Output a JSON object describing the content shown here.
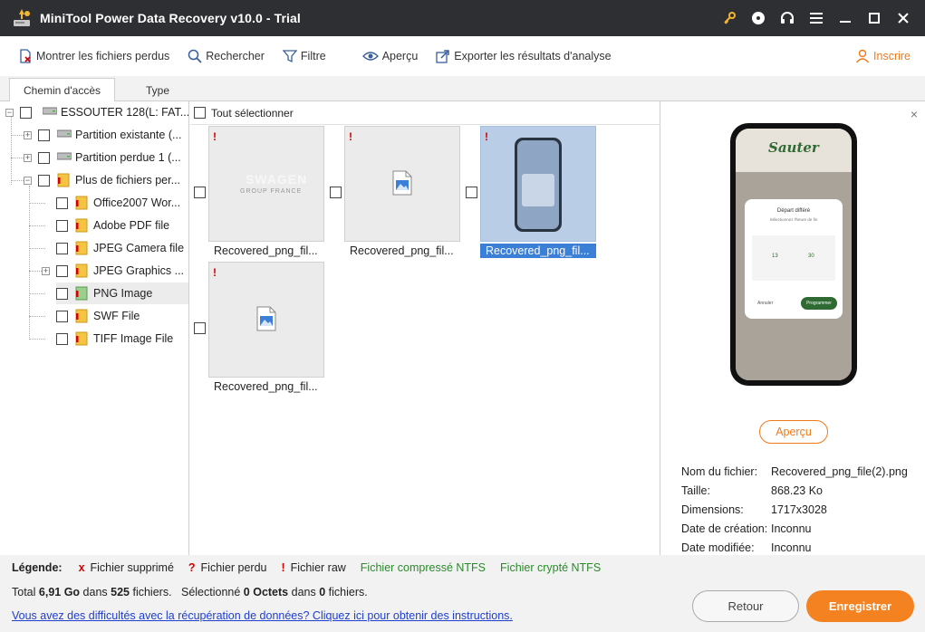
{
  "window": {
    "title": "MiniTool Power Data Recovery v10.0 - Trial"
  },
  "toolbar": {
    "show_lost": "Montrer les fichiers perdus",
    "search": "Rechercher",
    "filter": "Filtre",
    "preview": "Aperçu",
    "export": "Exporter les résultats d'analyse",
    "signup": "Inscrire"
  },
  "tabs": [
    {
      "label": "Chemin d'accès",
      "active": true
    },
    {
      "label": "Type",
      "active": false
    }
  ],
  "tree": {
    "items": [
      {
        "label": "ESSOUTER 128(L: FAT...",
        "icon": "drive-icon"
      },
      {
        "label": "Partition existante (...",
        "icon": "drive-icon"
      },
      {
        "label": "Partition perdue 1 (...",
        "icon": "drive-icon"
      },
      {
        "label": "Plus de fichiers per...",
        "icon": "raw-folder-icon"
      },
      {
        "label": "Office2007 Wor...",
        "icon": "raw-folder-icon"
      },
      {
        "label": "Adobe PDF file",
        "icon": "raw-folder-icon"
      },
      {
        "label": "JPEG Camera file",
        "icon": "raw-folder-icon"
      },
      {
        "label": "JPEG Graphics ...",
        "icon": "raw-folder-icon"
      },
      {
        "label": "PNG Image",
        "icon": "png-folder-icon"
      },
      {
        "label": "SWF File",
        "icon": "raw-folder-icon"
      },
      {
        "label": "TIFF Image File",
        "icon": "raw-folder-icon"
      }
    ]
  },
  "grid": {
    "select_all": "Tout sélectionner",
    "files": [
      {
        "name": "Recovered_png_fil...",
        "thumb": "vw-logo",
        "raw_mark": "!"
      },
      {
        "name": "Recovered_png_fil...",
        "thumb": "image-icon",
        "raw_mark": "!"
      },
      {
        "name": "Recovered_png_fil...",
        "thumb": "phone-screenshot",
        "raw_mark": "!"
      },
      {
        "name": "Recovered_png_fil...",
        "thumb": "image-icon",
        "raw_mark": "!"
      }
    ],
    "vw_text_1": "SWAGEN",
    "vw_text_2": "GROUP FRANCE"
  },
  "preview": {
    "phone_brand": "Sauter",
    "phone_dialog_title": "Départ différé",
    "phone_dialog_sub": "Sélectionnez l'heure de fin",
    "phone_hour": "13",
    "phone_min": "30",
    "phone_cancel": "Annuler",
    "phone_confirm": "Programmer",
    "button": "Aperçu",
    "info": [
      {
        "label": "Nom du fichier:",
        "value": "Recovered_png_file(2).png"
      },
      {
        "label": "Taille:",
        "value": "868.23 Ko"
      },
      {
        "label": "Dimensions:",
        "value": "1717x3028"
      },
      {
        "label": "Date de création:",
        "value": "Inconnu"
      },
      {
        "label": "Date modifiée:",
        "value": "Inconnu"
      }
    ]
  },
  "legend": {
    "title": "Légende:",
    "deleted_sym": "x",
    "deleted": "Fichier supprimé",
    "lost_sym": "?",
    "lost": "Fichier perdu",
    "raw_sym": "!",
    "raw": "Fichier raw",
    "ntfs_compressed": "Fichier compressé NTFS",
    "ntfs_encrypted": "Fichier crypté NTFS",
    "red": "#d40000",
    "green": "#2a8a2a"
  },
  "summary": {
    "prefix": "Total",
    "size": "6,91 Go",
    "in": "dans",
    "count": "525",
    "files_word": "fichiers.",
    "selected_prefix": "Sélectionné",
    "selected_size": "0 Octets",
    "in2": "dans",
    "selected_count": "0",
    "files_word2": "fichiers."
  },
  "help_link": "Vous avez des difficultés avec la récupération de données? Cliquez ici pour obtenir des instructions.",
  "buttons": {
    "back": "Retour",
    "save": "Enregistrer"
  },
  "colors": {
    "accent": "#f58220",
    "titlebar": "#2e2f33",
    "selection": "#3b7fd6"
  }
}
